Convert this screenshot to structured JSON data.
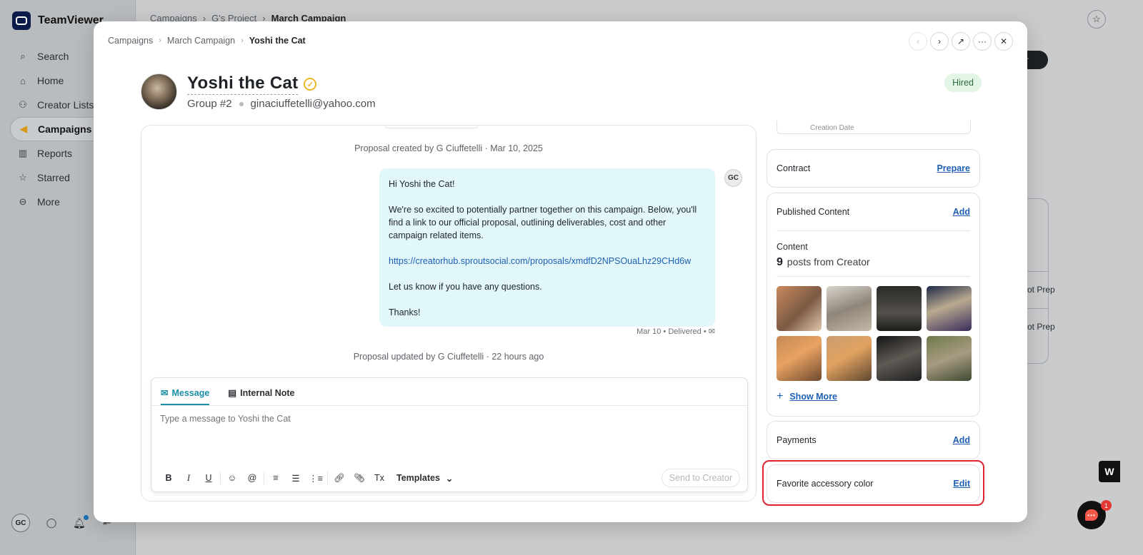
{
  "app": {
    "brand": "TeamViewer",
    "nav": [
      {
        "label": "Search",
        "icon": "search-icon"
      },
      {
        "label": "Home",
        "icon": "home-icon"
      },
      {
        "label": "Creator Lists",
        "icon": "users-icon"
      },
      {
        "label": "Campaigns",
        "icon": "megaphone-icon",
        "active": true
      },
      {
        "label": "Reports",
        "icon": "bar-chart-icon"
      },
      {
        "label": "Starred",
        "icon": "star-icon"
      },
      {
        "label": "More",
        "icon": "more-icon"
      }
    ],
    "user_initials": "GC",
    "background_breadcrumb": [
      "Campaigns",
      "G's Project",
      "March Campaign"
    ],
    "background_fragments": {
      "pill": "ator",
      "row1": "ot Prep",
      "row2": "ot Prep"
    },
    "chat_badge": "1",
    "w_widget": "W"
  },
  "modal": {
    "breadcrumb": [
      "Campaigns",
      "March Campaign",
      "Yoshi the Cat"
    ],
    "creator": {
      "name": "Yoshi the Cat",
      "group": "Group #2",
      "email": "ginaciuffetelli@yahoo.com",
      "status": "Hired"
    },
    "conversation": {
      "event_created": "Proposal created by G Ciuffetelli · Mar 10, 2025",
      "sender_initials": "GC",
      "message": {
        "greeting": "Hi Yoshi the Cat!",
        "body": "We're so excited to potentially partner together on this campaign. Below, you'll find a link to our official proposal, outlining deliverables, cost and other campaign related items.",
        "link": "https://creatorhub.sproutsocial.com/proposals/xmdfD2NPSOuaLhz29CHd6w",
        "closing": "Let us know if you have any questions.",
        "signoff": "Thanks!"
      },
      "message_meta": {
        "date": "Mar 10",
        "status": "Delivered"
      },
      "event_updated": "Proposal updated by G Ciuffetelli · 22 hours ago"
    },
    "composer": {
      "tabs": [
        "Message",
        "Internal Note"
      ],
      "placeholder": "Type a message to Yoshi the Cat",
      "templates_label": "Templates",
      "send_label": "Send to Creator"
    },
    "sidebar": {
      "top_stub": "Creation Date",
      "contract": {
        "label": "Contract",
        "action": "Prepare"
      },
      "published": {
        "label": "Published Content",
        "action": "Add"
      },
      "content": {
        "label": "Content",
        "count": "9",
        "suffix": "posts from Creator",
        "show_more": "Show More"
      },
      "payments": {
        "label": "Payments",
        "action": "Add"
      },
      "favorite": {
        "label": "Favorite accessory color",
        "action": "Edit"
      }
    }
  },
  "colors": {
    "accent": "#1a8fa8",
    "link": "#1d5fb3",
    "hired_bg": "#e3f5e6",
    "message_bg": "#e2f7fa",
    "highlight": "#e0242d"
  }
}
